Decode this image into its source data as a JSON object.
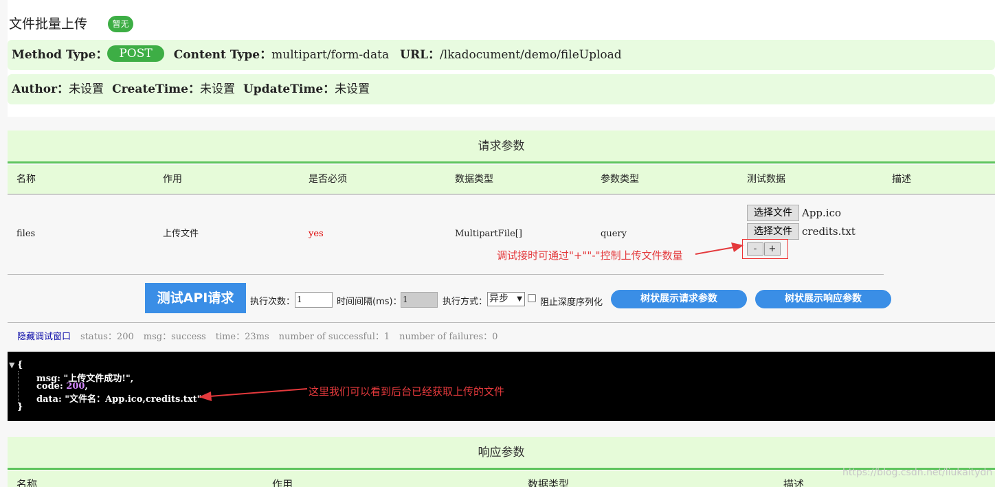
{
  "header": {
    "title": "文件批量上传",
    "badge": "暂无",
    "method_label": "Method Type：",
    "method_value": "POST",
    "content_type_label": "Content Type：",
    "content_type_value": "multipart/form-data",
    "url_label": "URL：",
    "url_value": "/lkadocument/demo/fileUpload",
    "author_label": "Author：",
    "author_value": "未设置",
    "create_label": "CreateTime：",
    "create_value": "未设置",
    "update_label": "UpdateTime：",
    "update_value": "未设置"
  },
  "request": {
    "section_title": "请求参数",
    "columns": [
      "名称",
      "作用",
      "是否必须",
      "数据类型",
      "参数类型",
      "测试数据",
      "描述"
    ],
    "row": {
      "name": "files",
      "purpose": "上传文件",
      "required": "yes",
      "data_type": "MultipartFile[]",
      "param_type": "query"
    },
    "files": [
      {
        "button": "选择文件",
        "name": "App.ico"
      },
      {
        "button": "选择文件",
        "name": "credits.txt"
      }
    ],
    "minus_label": "-",
    "plus_label": "+",
    "annotation": "调试接时可通过\"+\"\"-\"控制上传文件数量"
  },
  "controls": {
    "test_button": "测试API请求",
    "exec_count_label": "执行次数：",
    "exec_count_value": "1",
    "interval_label": "时间间隔(ms)：",
    "interval_value": "1",
    "mode_label": "执行方式：",
    "mode_value": "异步",
    "deep_serialize_label": "阻止深度序列化",
    "tree_request_button": "树状展示请求参数",
    "tree_response_button": "树状展示响应参数"
  },
  "status": {
    "hide_link": "隐藏调试窗口",
    "status": "status：200",
    "msg": "msg：success",
    "time": "time：23ms",
    "successful": "number of successful：1",
    "failures": "number of failures：0"
  },
  "console": {
    "open_brace": "{",
    "msg_key": "msg:",
    "msg_value": "\"上传文件成功!\",",
    "code_key": "code:",
    "code_value": "200",
    "code_comma": ",",
    "data_key": "data:",
    "data_value": "\"文件名：App.ico,credits.txt\"",
    "close_brace": "}",
    "annotation": "这里我们可以看到后台已经获取上传的文件"
  },
  "response": {
    "section_title": "响应参数",
    "columns": [
      "名称",
      "作用",
      "数据类型",
      "描述"
    ]
  },
  "watermark": "https://blog.csdn.net/liukaitydn",
  "colors": {
    "green_badge": "#3dae45",
    "section_bg": "#e6fbd9",
    "accent_blue": "#3a8ee6",
    "annotation_red": "#e4393c"
  }
}
